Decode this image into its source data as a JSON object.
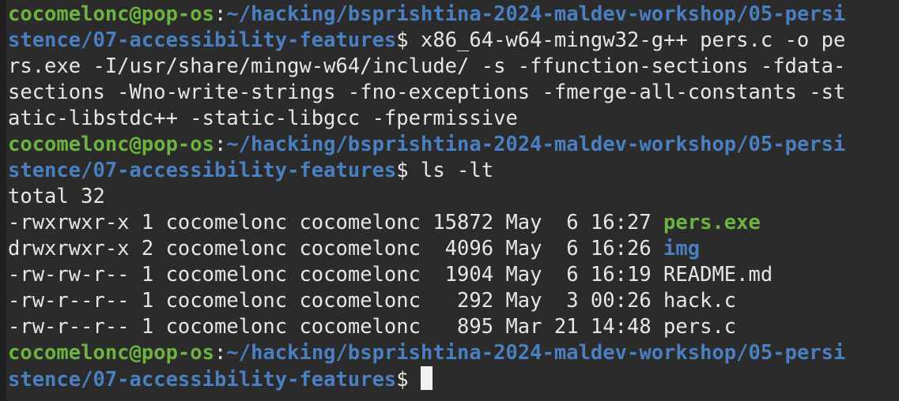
{
  "prompt": {
    "user_host": "cocomelonc@pop-os",
    "colon": ":",
    "path_part1": "~/hacking/bsprishtina-2024-maldev-workshop/05-persi",
    "path_part2": "stence/07-accessibility-features",
    "dollar": "$ "
  },
  "command1": {
    "line1_text": "x86_64-w64-mingw32-g++ pers.c -o pe",
    "line2": "rs.exe -I/usr/share/mingw-w64/include/ -s -ffunction-sections -fdata-",
    "line3": "sections -Wno-write-strings -fno-exceptions -fmerge-all-constants -st",
    "line4": "atic-libstdc++ -static-libgcc -fpermissive"
  },
  "command2": {
    "text": "ls -lt"
  },
  "ls_output": {
    "total": "total 32",
    "entries": [
      {
        "meta": "-rwxrwxr-x 1 cocomelonc cocomelonc 15872 May  6 16:27 ",
        "name": "pers.exe",
        "kind": "exe"
      },
      {
        "meta": "drwxrwxr-x 2 cocomelonc cocomelonc  4096 May  6 16:26 ",
        "name": "img",
        "kind": "dir"
      },
      {
        "meta": "-rw-rw-r-- 1 cocomelonc cocomelonc  1904 May  6 16:19 ",
        "name": "README.md",
        "kind": "file"
      },
      {
        "meta": "-rw-r--r-- 1 cocomelonc cocomelonc   292 May  3 00:26 ",
        "name": "hack.c",
        "kind": "file"
      },
      {
        "meta": "-rw-r--r-- 1 cocomelonc cocomelonc   895 Mar 21 14:48 ",
        "name": "pers.c",
        "kind": "file"
      }
    ]
  },
  "colors": {
    "background": "#2b2b2b",
    "user_green": "#6db33f",
    "path_blue": "#4a7fc1",
    "text": "#e6e6e6"
  }
}
